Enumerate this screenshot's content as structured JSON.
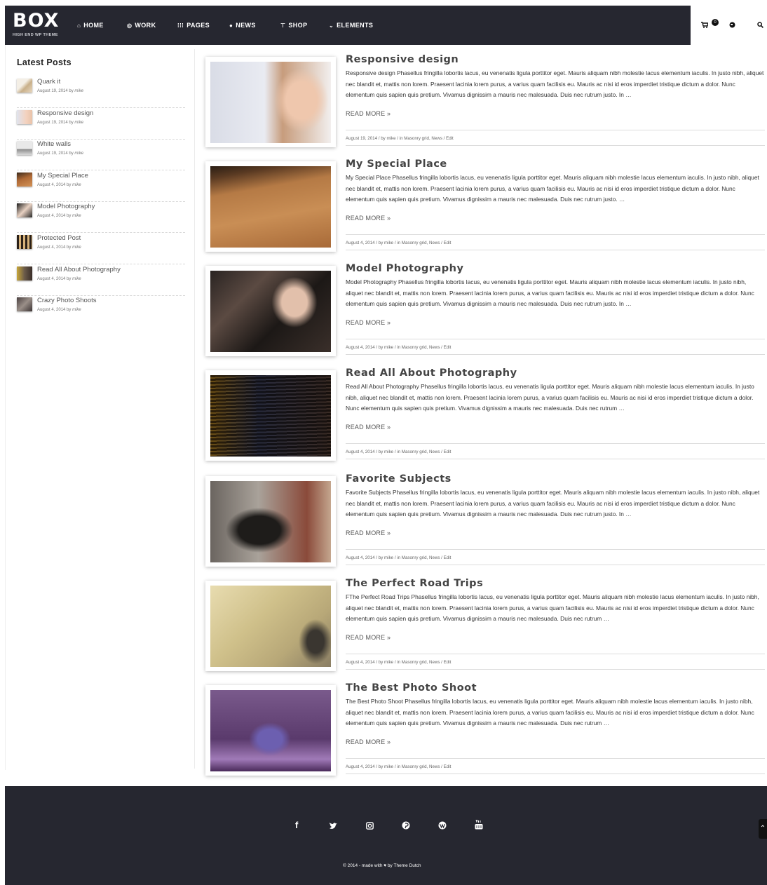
{
  "header": {
    "logo": "BOX",
    "tagline": "HIGH END WP THEME",
    "nav": [
      {
        "label": "HOME",
        "icon": "home-icon"
      },
      {
        "label": "WORK",
        "icon": "target-icon"
      },
      {
        "label": "PAGES",
        "icon": "grid-icon"
      },
      {
        "label": "NEWS",
        "icon": "chat-icon"
      },
      {
        "label": "SHOP",
        "icon": "cart-icon"
      },
      {
        "label": "ELEMENTS",
        "icon": "chevron-down-icon"
      }
    ],
    "cart_count": "0"
  },
  "sidebar": {
    "title": "Latest Posts",
    "items": [
      {
        "title": "Quark it",
        "date": "August 19, 2014",
        "by": "by",
        "author": "mike"
      },
      {
        "title": "Responsive design",
        "date": "August 19, 2014",
        "by": "by",
        "author": "mike"
      },
      {
        "title": "White walls",
        "date": "August 19, 2014",
        "by": "by",
        "author": "mike"
      },
      {
        "title": "My Special Place",
        "date": "August 4, 2014",
        "by": "by",
        "author": "mike"
      },
      {
        "title": "Model Photography",
        "date": "August 4, 2014",
        "by": "by",
        "author": "mike"
      },
      {
        "title": "Protected Post",
        "date": "August 4, 2014",
        "by": "by",
        "author": "mike"
      },
      {
        "title": "Read All About Photography",
        "date": "August 4, 2014",
        "by": "by",
        "author": "mike"
      },
      {
        "title": "Crazy Photo Shoots",
        "date": "August 4, 2014",
        "by": "by",
        "author": "mike"
      }
    ]
  },
  "posts": [
    {
      "title": "Responsive design",
      "excerpt": "Responsive design Phasellus fringilla lobortis lacus, eu venenatis ligula porttitor eget. Mauris aliquam nibh molestie lacus elementum iaculis. In justo nibh, aliquet nec blandit et, mattis non lorem. Praesent lacinia lorem purus, a varius quam facilisis eu. Mauris ac nisi id eros imperdiet tristique dictum a dolor. Nunc elementum quis sapien quis pretium. Vivamus dignissim a mauris nec malesuada. Duis nec rutrum justo. In …",
      "read_more": "READ MORE »",
      "meta": "August 19, 2014 / by mike / in Masonry grid, News / Edit"
    },
    {
      "title": "My Special Place",
      "excerpt": "My Special Place Phasellus fringilla lobortis lacus, eu venenatis ligula porttitor eget. Mauris aliquam nibh molestie lacus elementum iaculis. In justo nibh, aliquet nec blandit et, mattis non lorem. Praesent lacinia lorem purus, a varius quam facilisis eu. Mauris ac nisi id eros imperdiet tristique dictum a dolor. Nunc elementum quis sapien quis pretium. Vivamus dignissim a mauris nec malesuada. Duis nec rutrum justo. …",
      "read_more": "READ MORE »",
      "meta": "August 4, 2014 / by mike / in Masonry grid, News / Edit"
    },
    {
      "title": "Model Photography",
      "excerpt": "Model Photography Phasellus fringilla lobortis lacus, eu venenatis ligula porttitor eget. Mauris aliquam nibh molestie lacus elementum iaculis. In justo nibh, aliquet nec blandit et, mattis non lorem. Praesent lacinia lorem purus, a varius quam facilisis eu. Mauris ac nisi id eros imperdiet tristique dictum a dolor. Nunc elementum quis sapien quis pretium. Vivamus dignissim a mauris nec malesuada. Duis nec rutrum justo. In …",
      "read_more": "READ MORE »",
      "meta": "August 4, 2014 / by mike / in Masonry grid, News / Edit"
    },
    {
      "title": "Read All About Photography",
      "excerpt": "Read All About Photography Phasellus fringilla lobortis lacus, eu venenatis ligula porttitor eget. Mauris aliquam nibh molestie lacus elementum iaculis. In justo nibh, aliquet nec blandit et, mattis non lorem. Praesent lacinia lorem purus, a varius quam facilisis eu. Mauris ac nisi id eros imperdiet tristique dictum a dolor. Nunc elementum quis sapien quis pretium. Vivamus dignissim a mauris nec malesuada. Duis nec rutrum …",
      "read_more": "READ MORE »",
      "meta": "August 4, 2014 / by mike / in Masonry grid, News / Edit"
    },
    {
      "title": "Favorite Subjects",
      "excerpt": "Favorite Subjects Phasellus fringilla lobortis lacus, eu venenatis ligula porttitor eget. Mauris aliquam nibh molestie lacus elementum iaculis. In justo nibh, aliquet nec blandit et, mattis non lorem. Praesent lacinia lorem purus, a varius quam facilisis eu. Mauris ac nisi id eros imperdiet tristique dictum a dolor. Nunc elementum quis sapien quis pretium. Vivamus dignissim a mauris nec malesuada. Duis nec rutrum justo. In …",
      "read_more": "READ MORE »",
      "meta": "August 4, 2014 / by mike / in Masonry grid, News / Edit"
    },
    {
      "title": "The Perfect Road Trips",
      "excerpt": "FThe Perfect Road Trips Phasellus fringilla lobortis lacus, eu venenatis ligula porttitor eget. Mauris aliquam nibh molestie lacus elementum iaculis. In justo nibh, aliquet nec blandit et, mattis non lorem. Praesent lacinia lorem purus, a varius quam facilisis eu. Mauris ac nisi id eros imperdiet tristique dictum a dolor. Nunc elementum quis sapien quis pretium. Vivamus dignissim a mauris nec malesuada. Duis nec rutrum …",
      "read_more": "READ MORE »",
      "meta": "August 4, 2014 / by mike / in Masonry grid, News / Edit"
    },
    {
      "title": "The Best Photo Shoot",
      "excerpt": "The Best Photo Shoot Phasellus fringilla lobortis lacus, eu venenatis ligula porttitor eget. Mauris aliquam nibh molestie lacus elementum iaculis. In justo nibh, aliquet nec blandit et, mattis non lorem. Praesent lacinia lorem purus, a varius quam facilisis eu. Mauris ac nisi id eros imperdiet tristique dictum a dolor. Nunc elementum quis sapien quis pretium. Vivamus dignissim a mauris nec malesuada. Duis nec rutrum …",
      "read_more": "READ MORE »",
      "meta": "August 4, 2014 / by mike / in Masonry grid, News / Edit"
    }
  ],
  "footer": {
    "social_icons": [
      "facebook-icon",
      "twitter-icon",
      "instagram-icon",
      "pinterest-icon",
      "wordpress-icon",
      "youtube-icon"
    ],
    "copyright": "© 2014 - made with ♥ by Theme Dutch"
  },
  "colors": {
    "header_bg": "#262730",
    "footer_bg": "#262730",
    "text": "#444444"
  }
}
